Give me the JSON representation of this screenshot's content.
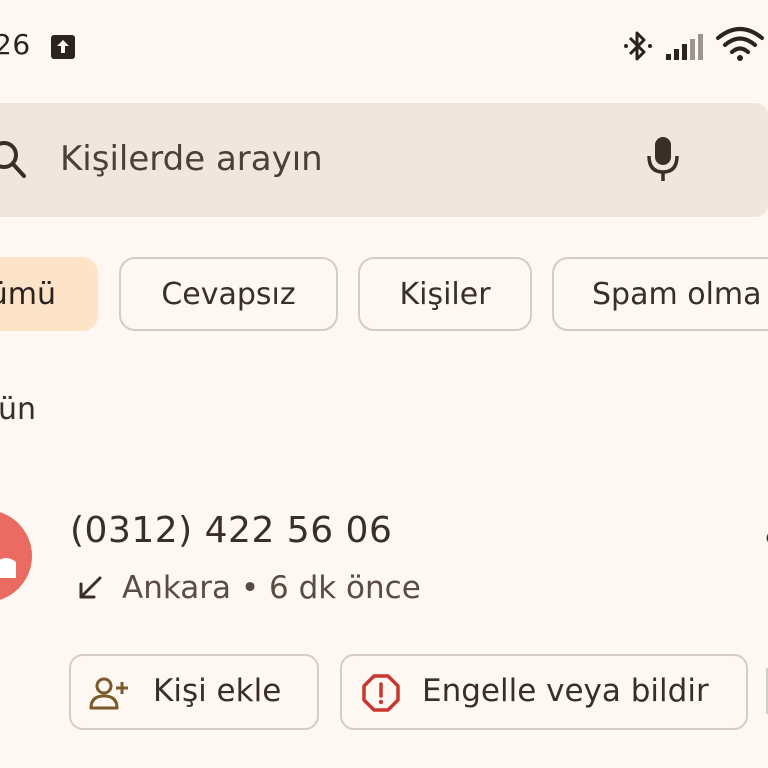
{
  "status_bar": {
    "time": "26",
    "icons": [
      "upload-icon",
      "bluetooth-icon",
      "signal-icon",
      "wifi-icon"
    ]
  },
  "search": {
    "placeholder": "Kişilerde arayın",
    "icons": [
      "search-icon",
      "mic-icon"
    ]
  },
  "filters": {
    "chips": [
      {
        "label": "ümü",
        "selected": true
      },
      {
        "label": "Cevapsız",
        "selected": false
      },
      {
        "label": "Kişiler",
        "selected": false
      },
      {
        "label": "Spam olma",
        "selected": false
      }
    ]
  },
  "section": {
    "header": "ün"
  },
  "call": {
    "number": "(0312) 422 56 06",
    "meta": "Ankara • 6 dk önce",
    "direction_icon": "incoming-call-icon",
    "actions": [
      {
        "label": "Kişi ekle",
        "icon": "add-person-icon"
      },
      {
        "label": "Engelle veya bildir",
        "icon": "report-icon"
      }
    ]
  },
  "colors": {
    "background": "#FFF7F2",
    "search_bg": "#F1E6DD",
    "chip_selected": "#FDE3C8",
    "avatar": "#EA6B62",
    "report_red": "#C8372D",
    "add_person_brown": "#7A5A2A"
  }
}
